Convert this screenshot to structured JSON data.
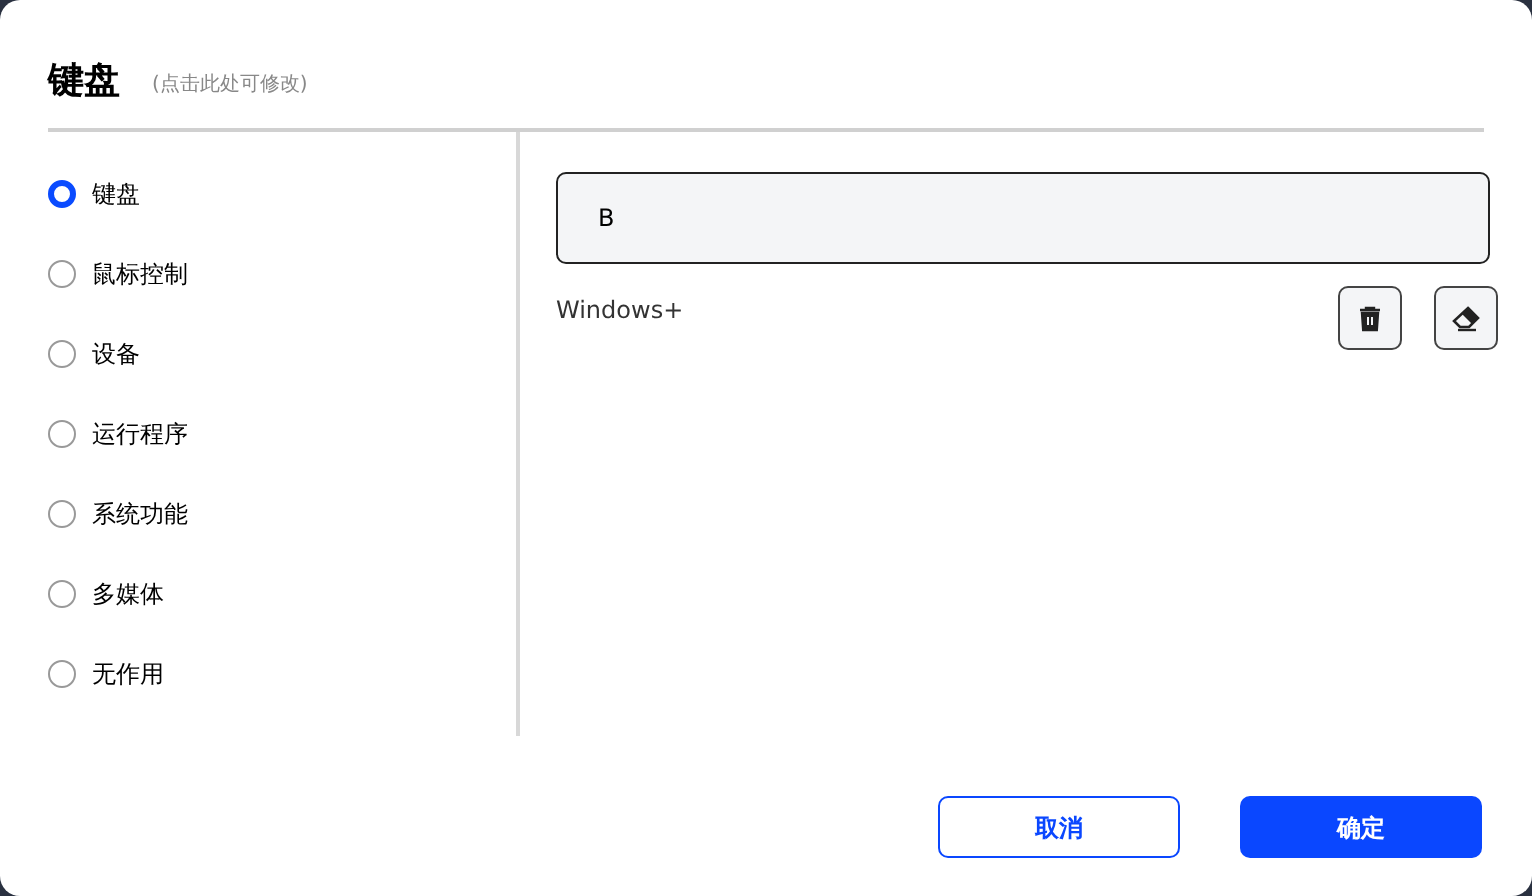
{
  "title": "键盘",
  "title_hint": "(点击此处可修改)",
  "options": [
    {
      "label": "键盘",
      "selected": true
    },
    {
      "label": "鼠标控制",
      "selected": false
    },
    {
      "label": "设备",
      "selected": false
    },
    {
      "label": "运行程序",
      "selected": false
    },
    {
      "label": "系统功能",
      "selected": false
    },
    {
      "label": "多媒体",
      "selected": false
    },
    {
      "label": "无作用",
      "selected": false
    }
  ],
  "key_field": {
    "value": "B"
  },
  "modifier_label": "Windows+",
  "buttons": [
    {
      "label": "取消",
      "kind": "secondary"
    },
    {
      "label": "确定",
      "kind": "primary"
    }
  ]
}
